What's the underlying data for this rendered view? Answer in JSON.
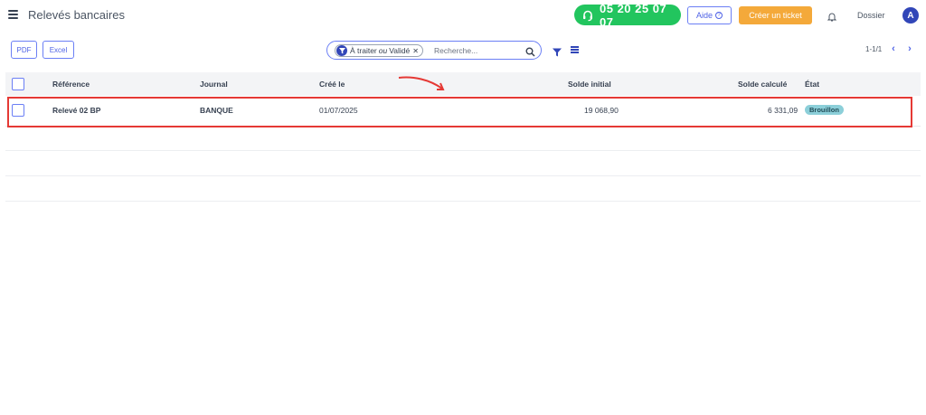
{
  "header": {
    "title": "Relevés bancaires",
    "phone": "05 20 25 07 07",
    "help_label": "Aide",
    "help_icon": "?",
    "ticket_label": "Créer un ticket",
    "dossier_label": "Dossier",
    "avatar_initial": "A"
  },
  "toolbar": {
    "pdf_label": "PDF",
    "excel_label": "Excel",
    "filter_chip": {
      "value_a": "À traiter",
      "separator": "ou",
      "value_b": "Validé"
    },
    "search_placeholder": "Recherche...",
    "pager_text": "1-1/1"
  },
  "table": {
    "columns": [
      "Référence",
      "Journal",
      "Créé le",
      "Solde initial",
      "Solde calculé",
      "État"
    ],
    "rows": [
      {
        "reference": "Relevé 02 BP",
        "journal": "BANQUE",
        "created": "01/07/2025",
        "solde_initial": "19 068,90",
        "solde_calcule": "6 331,09",
        "etat": "Brouillon"
      }
    ]
  },
  "colors": {
    "accent": "#4f63e6",
    "phone_green": "#22c55e",
    "ticket_orange": "#f4a93a",
    "highlight_red": "#e53935",
    "status_badge": "#8ccfd9"
  }
}
